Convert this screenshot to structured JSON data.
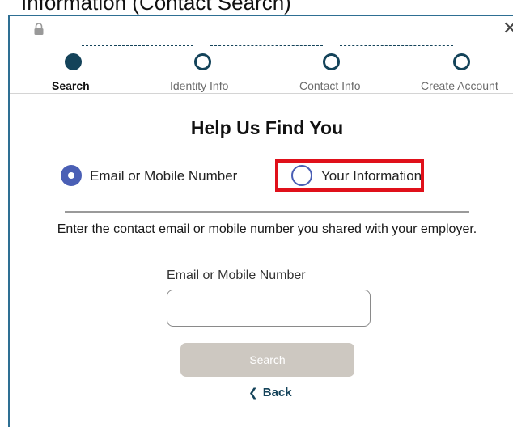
{
  "header": {
    "caption_partial": "Information (Contact Search)"
  },
  "stepper": {
    "steps": [
      {
        "label": "Search",
        "state": "active"
      },
      {
        "label": "Identity Info",
        "state": "pending"
      },
      {
        "label": "Contact Info",
        "state": "pending"
      },
      {
        "label": "Create Account",
        "state": "pending"
      }
    ]
  },
  "main": {
    "title": "Help Us Find You",
    "options": [
      {
        "label": "Email or Mobile Number",
        "selected": true
      },
      {
        "label": "Your Information",
        "selected": false
      }
    ],
    "instructions": "Enter the contact email or mobile number you shared with your employer.",
    "field_label": "Email or Mobile Number",
    "field_value": "",
    "search_label": "Search",
    "back_label": "Back"
  },
  "colors": {
    "accent": "#14435a",
    "radio": "#4a5fb5",
    "highlight": "#e0101a",
    "button_disabled": "#cdc8c1"
  },
  "icons": {
    "lock": "lock-icon",
    "close": "close-icon",
    "back": "chevron-left-icon"
  }
}
